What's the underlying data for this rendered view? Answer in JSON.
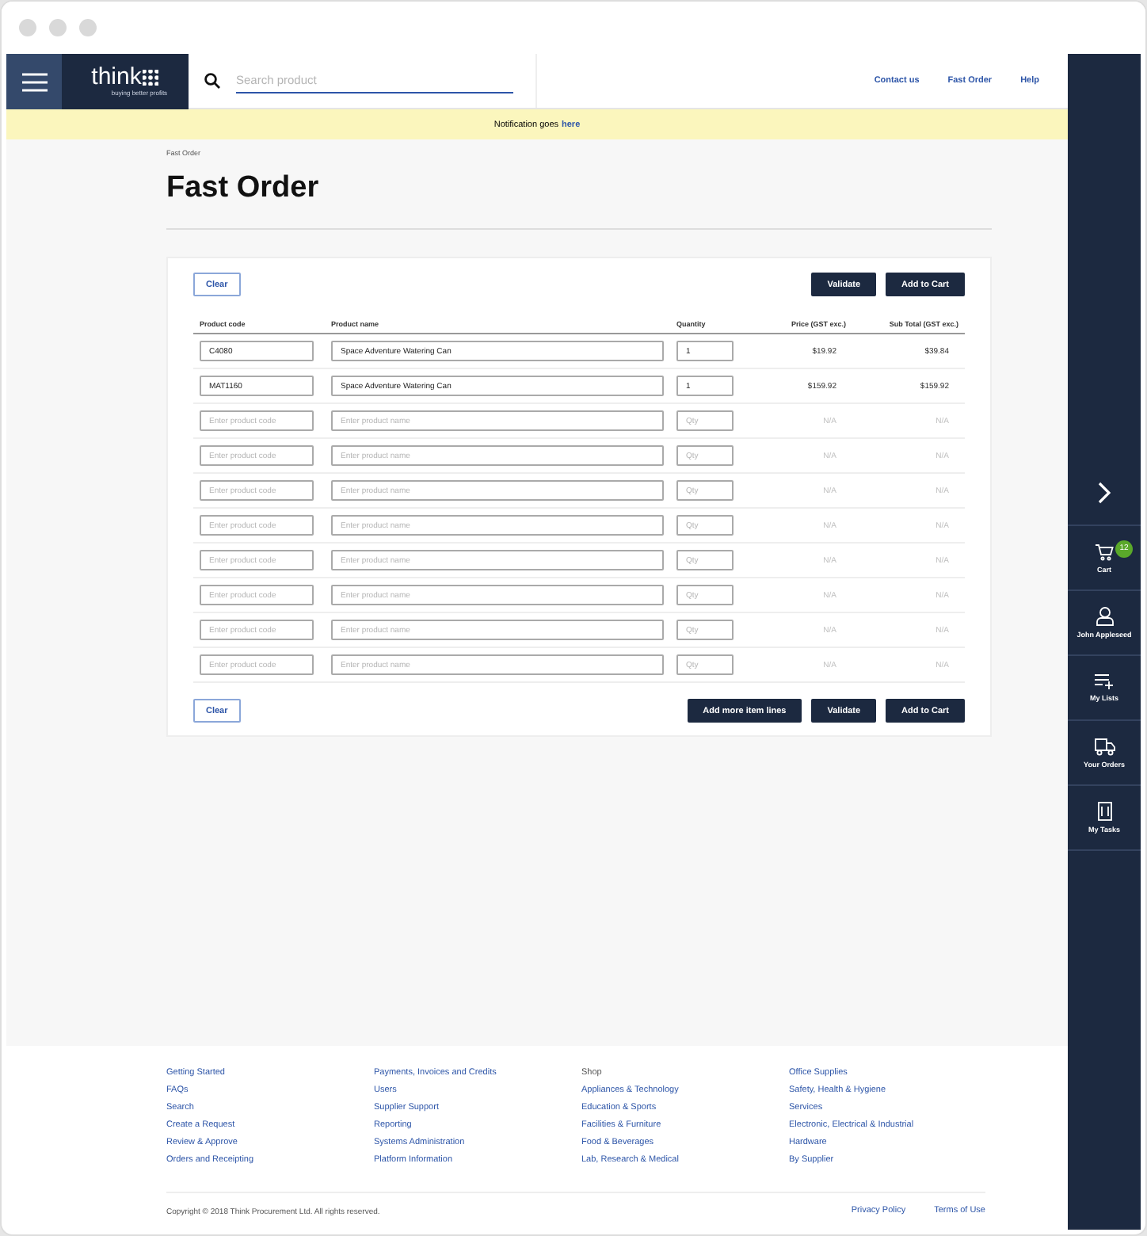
{
  "header": {
    "logo": "think",
    "tagline": "buying better profits",
    "search": {
      "placeholder": "Search product"
    },
    "links": [
      "Contact us",
      "Fast Order",
      "Help"
    ]
  },
  "notification": {
    "text": "Notification goes",
    "link": "here"
  },
  "breadcrumb": "Fast Order",
  "title": "Fast Order",
  "top_actions": {
    "clear": "Clear",
    "buttons": [
      "Validate",
      "Add to Cart"
    ]
  },
  "table": {
    "columns": [
      "Product code",
      "Product name",
      "Quantity",
      "Price (GST exc.)",
      "Sub Total (GST exc.)"
    ],
    "rows": [
      {
        "kind": "filled",
        "code": {
          "value": "C4080"
        },
        "name": {
          "value": "Space Adventure Watering Can"
        },
        "qty": {
          "value": "1"
        },
        "price": "$19.92",
        "subtotal": "$39.84"
      },
      {
        "kind": "filled",
        "code": {
          "value": "MAT1160"
        },
        "name": {
          "value": "Space Adventure Watering Can"
        },
        "qty": {
          "value": "1"
        },
        "price": "$159.92",
        "subtotal": "$159.92"
      },
      {
        "kind": "empty",
        "code": {
          "placeholder": "Enter product code"
        },
        "name": {
          "placeholder": "Enter product name"
        },
        "qty": {
          "placeholder": "Qty"
        },
        "price": "N/A",
        "subtotal": "N/A"
      },
      {
        "kind": "empty",
        "code": {
          "placeholder": "Enter product code"
        },
        "name": {
          "placeholder": "Enter product name"
        },
        "qty": {
          "placeholder": "Qty"
        },
        "price": "N/A",
        "subtotal": "N/A"
      },
      {
        "kind": "empty",
        "code": {
          "placeholder": "Enter product code"
        },
        "name": {
          "placeholder": "Enter product name"
        },
        "qty": {
          "placeholder": "Qty"
        },
        "price": "N/A",
        "subtotal": "N/A"
      },
      {
        "kind": "empty",
        "code": {
          "placeholder": "Enter product code"
        },
        "name": {
          "placeholder": "Enter product name"
        },
        "qty": {
          "placeholder": "Qty"
        },
        "price": "N/A",
        "subtotal": "N/A"
      },
      {
        "kind": "empty",
        "code": {
          "placeholder": "Enter product code"
        },
        "name": {
          "placeholder": "Enter product name"
        },
        "qty": {
          "placeholder": "Qty"
        },
        "price": "N/A",
        "subtotal": "N/A"
      },
      {
        "kind": "empty",
        "code": {
          "placeholder": "Enter product code"
        },
        "name": {
          "placeholder": "Enter product name"
        },
        "qty": {
          "placeholder": "Qty"
        },
        "price": "N/A",
        "subtotal": "N/A"
      },
      {
        "kind": "empty",
        "code": {
          "placeholder": "Enter product code"
        },
        "name": {
          "placeholder": "Enter product name"
        },
        "qty": {
          "placeholder": "Qty"
        },
        "price": "N/A",
        "subtotal": "N/A"
      },
      {
        "kind": "empty",
        "code": {
          "placeholder": "Enter product code"
        },
        "name": {
          "placeholder": "Enter product name"
        },
        "qty": {
          "placeholder": "Qty"
        },
        "price": "N/A",
        "subtotal": "N/A"
      }
    ]
  },
  "bottom_actions": {
    "clear": "Clear",
    "buttons": [
      "Add more item lines",
      "Validate",
      "Add to Cart"
    ]
  },
  "footer": {
    "columns": [
      {
        "items": [
          {
            "kind": "link",
            "label": "Getting Started"
          },
          {
            "kind": "link",
            "label": "FAQs"
          },
          {
            "kind": "link",
            "label": "Search"
          },
          {
            "kind": "link",
            "label": "Create a Request"
          },
          {
            "kind": "link",
            "label": "Review & Approve"
          },
          {
            "kind": "link",
            "label": "Orders and Receipting"
          }
        ]
      },
      {
        "items": [
          {
            "kind": "link",
            "label": "Payments, Invoices and Credits"
          },
          {
            "kind": "link",
            "label": "Users"
          },
          {
            "kind": "link",
            "label": "Supplier Support"
          },
          {
            "kind": "link",
            "label": "Reporting"
          },
          {
            "kind": "link",
            "label": "Systems Administration"
          },
          {
            "kind": "link",
            "label": "Platform Information"
          }
        ]
      },
      {
        "items": [
          {
            "kind": "heading",
            "label": "Shop"
          },
          {
            "kind": "link",
            "label": "Appliances & Technology"
          },
          {
            "kind": "link",
            "label": "Education & Sports"
          },
          {
            "kind": "link",
            "label": "Facilities & Furniture"
          },
          {
            "kind": "link",
            "label": "Food & Beverages"
          },
          {
            "kind": "link",
            "label": "Lab, Research & Medical"
          }
        ]
      },
      {
        "items": [
          {
            "kind": "link",
            "label": "Office Supplies"
          },
          {
            "kind": "link",
            "label": "Safety, Health & Hygiene"
          },
          {
            "kind": "link",
            "label": "Services"
          },
          {
            "kind": "link",
            "label": "Electronic, Electrical & Industrial"
          },
          {
            "kind": "link",
            "label": "Hardware"
          },
          {
            "kind": "link",
            "label": "By Supplier"
          }
        ]
      }
    ],
    "copyright": "Copyright © 2018 Think Procurement Ltd. All rights reserved.",
    "links": [
      "Privacy Policy",
      "Terms of Use"
    ]
  },
  "sidebar": {
    "items": [
      {
        "kind": "cart",
        "label": "Cart",
        "badge": "12"
      },
      {
        "kind": "user",
        "label": "John Appleseed"
      },
      {
        "kind": "lists",
        "label": "My Lists"
      },
      {
        "kind": "orders",
        "label": "Your Orders"
      },
      {
        "kind": "tasks",
        "label": "My Tasks"
      }
    ]
  }
}
